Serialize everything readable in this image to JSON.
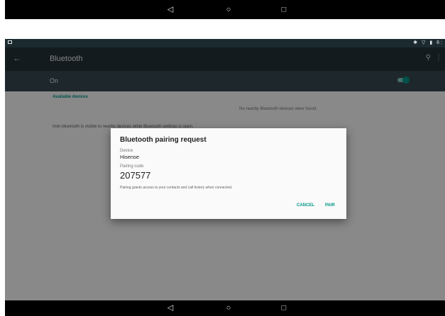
{
  "navbar": {
    "back_glyph": "◁",
    "home_glyph": "○",
    "recent_glyph": "□"
  },
  "statusbar": {
    "right_text": "✱ ▽ ▮ 6:"
  },
  "appbar": {
    "back_glyph": "←",
    "title": "Bluetooth",
    "search_glyph": "⚲",
    "more_glyph": "⋮"
  },
  "bluetooth_toggle": {
    "label": "On",
    "state": "on"
  },
  "content": {
    "section_title": "Available devices",
    "empty_message": "No nearby Bluetooth devices were found.",
    "visibility_message": "tmin-bluetooth is visible to nearby devices while Bluetooth settings is open."
  },
  "dialog": {
    "title": "Bluetooth pairing request",
    "device_label": "Device",
    "device_value": "Hisense",
    "code_label": "Pairing code",
    "code_value": "207577",
    "note": "Pairing grants access to your contacts and call history when connected.",
    "cancel_label": "CANCEL",
    "pair_label": "PAIR"
  },
  "colors": {
    "accent": "#009688",
    "appbar": "#263238",
    "toggle_bar": "#37474f"
  }
}
